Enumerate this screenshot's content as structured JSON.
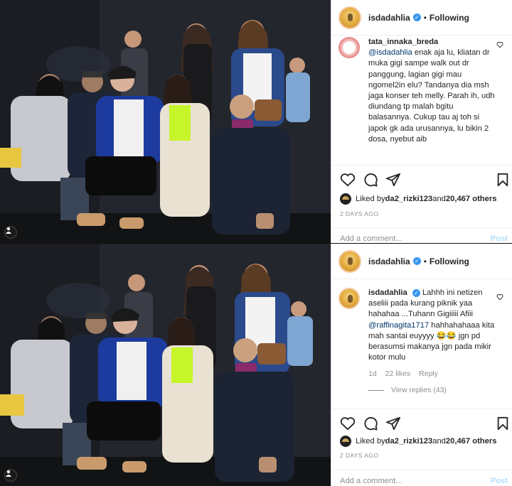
{
  "posts": [
    {
      "header": {
        "username": "isdadahlia",
        "follow_label": "Following"
      },
      "comment": {
        "username": "tata_innaka_breda",
        "mention": "@isdadahlia",
        "text": " enak aja lu, kliatan dr muka gigi sampe walk out dr panggung, lagian gigi mau ngomel2in elu? Tandanya dia msh jaga konser teh melly. Parah ih, udh diundang tp malah bgitu balasannya. Cukup tau aj toh si japok gk ada urusannya, lu bikin 2 dosa, nyebut aib"
      },
      "likes": {
        "liked_by": "Liked by ",
        "user": "da2_rizki123",
        "and": " and ",
        "count": "20,467 others"
      },
      "date": "2 DAYS AGO",
      "add_comment": {
        "placeholder": "Add a comment...",
        "post_label": "Post"
      }
    },
    {
      "header": {
        "username": "isdadahlia",
        "follow_label": "Following"
      },
      "comment": {
        "username": "isdadahlia",
        "text_a": "Lahhh ini netizen aseliii pada kurang piknik yaa hahahaa ...Tuhann Gigiiiii Afiii ",
        "mention": "@raffinagita1717",
        "text_b": " hahhahahaaa kita mah santai euyyyy 😂😂 jgn pd berasumsi makanya jgn pada mikir kotor mulu",
        "time": "1d",
        "likes": "22 likes",
        "reply_label": "Reply",
        "view_replies": "View replies (43)"
      },
      "likes": {
        "liked_by": "Liked by ",
        "user": "da2_rizki123",
        "and": " and ",
        "count": "20,467 others"
      },
      "date": "2 DAYS AGO",
      "add_comment": {
        "placeholder": "Add a comment...",
        "post_label": "Post"
      }
    }
  ],
  "colors": {
    "verified": "#3897f0",
    "mention": "#00376b",
    "muted": "#8e8e8e"
  },
  "icons": [
    "user-tag-icon",
    "verified-icon",
    "heart-icon",
    "comment-icon",
    "share-icon",
    "bookmark-icon"
  ]
}
